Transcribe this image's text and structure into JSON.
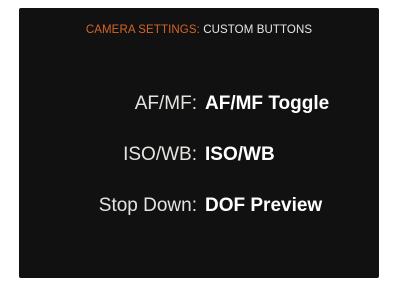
{
  "header": {
    "section": "CAMERA SETTINGS:",
    "subsection": "CUSTOM BUTTONS"
  },
  "rows": [
    {
      "label": "AF/MF:",
      "value": "AF/MF Toggle"
    },
    {
      "label": "ISO/WB:",
      "value": "ISO/WB"
    },
    {
      "label": "Stop Down:",
      "value": "DOF Preview"
    }
  ],
  "colors": {
    "background": "#121111",
    "accent": "#d5642a",
    "text": "#e6e4e1",
    "value_text": "#ffffff"
  }
}
